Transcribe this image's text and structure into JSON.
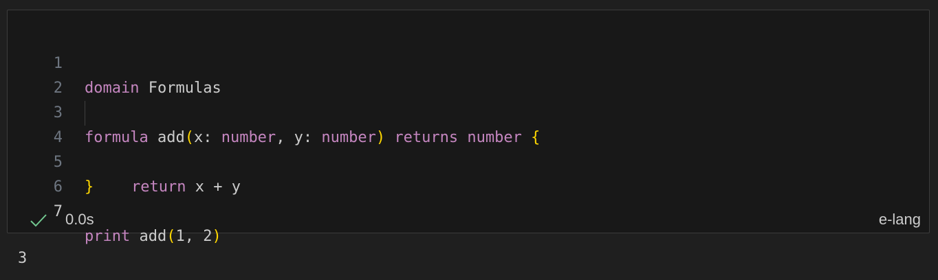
{
  "cell": {
    "lines": [
      {
        "number": "1",
        "tokens": {
          "t1": "domain",
          "t2": " Formulas"
        }
      },
      {
        "number": "2"
      },
      {
        "number": "3",
        "tokens": {
          "t1": "formula",
          "t2": " add",
          "t3": "(",
          "t4": "x: ",
          "t5": "number",
          "t6": ", y: ",
          "t7": "number",
          "t8": ")",
          "t9": " returns",
          "t10": " number",
          "t11": " {"
        }
      },
      {
        "number": "4",
        "tokens": {
          "t1": "return",
          "t2": " x + y"
        }
      },
      {
        "number": "5",
        "tokens": {
          "t1": "}"
        }
      },
      {
        "number": "6"
      },
      {
        "number": "7",
        "tokens": {
          "t1": "print",
          "t2": " add",
          "t3": "(",
          "t4": "1, 2",
          "t5": ")"
        }
      }
    ],
    "status": {
      "icon": "checkmark-icon",
      "icon_color": "#73c991",
      "timing": "0.0s",
      "language": "e-lang"
    }
  },
  "output": {
    "text": "3"
  }
}
